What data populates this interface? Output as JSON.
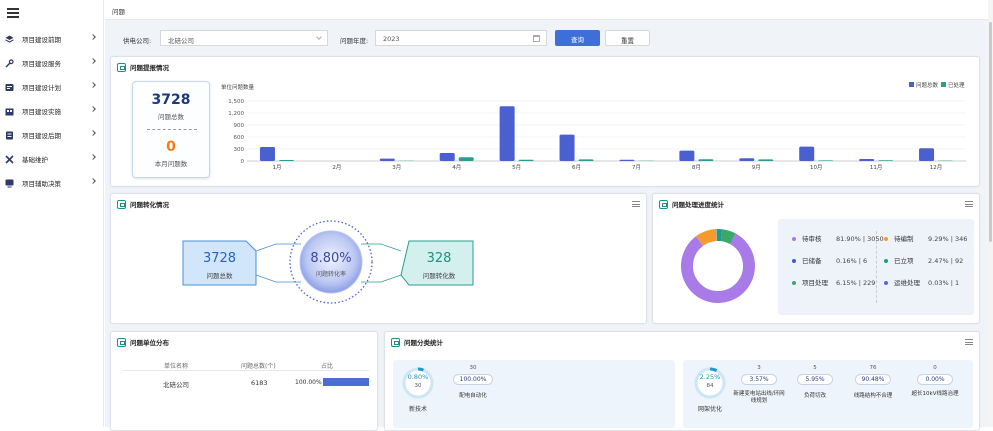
{
  "sidebar": {
    "items": [
      {
        "label": "项目建设前期",
        "icon": "layers-icon"
      },
      {
        "label": "项目建设服务",
        "icon": "tools-icon"
      },
      {
        "label": "项目建设计划",
        "icon": "plan-icon"
      },
      {
        "label": "项目建设实施",
        "icon": "build-icon"
      },
      {
        "label": "项目建设后期",
        "icon": "archive-icon"
      },
      {
        "label": "基础维护",
        "icon": "wrench-icon"
      },
      {
        "label": "项目辅助决策",
        "icon": "monitor-icon"
      }
    ]
  },
  "breadcrumb": "问题",
  "filter": {
    "company_label": "供电公司:",
    "company_value": "北碚公司",
    "year_label": "问题年度:",
    "year_value": "2023",
    "query_label": "查询",
    "reset_label": "重置"
  },
  "raise": {
    "title": "问题提报情况",
    "total_value": "3728",
    "total_label": "问题总数",
    "month_value": "0",
    "month_label": "本月问题数"
  },
  "chart_data": {
    "type": "bar",
    "title": "",
    "ylabel": "单位问题数量",
    "ylim": [
      0,
      1500
    ],
    "yticks": [
      "1,500",
      "1,200",
      "900",
      "600",
      "300",
      "0"
    ],
    "categories": [
      "1月",
      "2月",
      "3月",
      "4月",
      "5月",
      "6月",
      "7月",
      "8月",
      "9月",
      "10月",
      "11月",
      "12月"
    ],
    "series": [
      {
        "name": "问题总数",
        "color": "#4a5fd0",
        "values": [
          350,
          0,
          60,
          200,
          1370,
          660,
          30,
          260,
          70,
          360,
          50,
          320
        ]
      },
      {
        "name": "已处理",
        "color": "#2a9d8f",
        "values": [
          25,
          0,
          5,
          95,
          30,
          40,
          5,
          45,
          40,
          15,
          20,
          10
        ]
      }
    ],
    "legend": "top-right",
    "grid": true
  },
  "conversion": {
    "title": "问题转化情况",
    "left_value": "3728",
    "left_label": "问题总数",
    "center_value": "8.80%",
    "center_label": "问题转化率",
    "right_value": "328",
    "right_label": "问题转化数"
  },
  "progress": {
    "title": "问题处理进度统计",
    "items": [
      {
        "label": "待审核",
        "value": "81.90% | 3050",
        "color": "#a97be8",
        "pct": 81.9
      },
      {
        "label": "待编制",
        "value": "9.29% | 346",
        "color": "#f79a2e",
        "pct": 9.29
      },
      {
        "label": "已储备",
        "value": "0.16% | 6",
        "color": "#3b5bd6",
        "pct": 0.16
      },
      {
        "label": "已立项",
        "value": "2.47% | 92",
        "color": "#1f9a8e",
        "pct": 2.47
      },
      {
        "label": "项目处理",
        "value": "6.15% | 229",
        "color": "#3aa86b",
        "pct": 6.15
      },
      {
        "label": "运维处理",
        "value": "0.03% | 1",
        "color": "#5a6ad8",
        "pct": 0.03
      }
    ]
  },
  "unit": {
    "title": "问题单位分布",
    "headers": [
      "单位名称",
      "问题总数(个)",
      "占比"
    ],
    "rows": [
      {
        "name": "北碚公司",
        "count": "6183",
        "pct": "100.00%",
        "ratio": 1.0
      }
    ]
  },
  "category": {
    "title": "问题分类统计",
    "group1": {
      "ring_value": "0.80%",
      "ring_count": "30",
      "ring_pct": 0.8,
      "name": "新技术",
      "subs": [
        {
          "count": "30",
          "pct": "100.00%",
          "label": "配电自动化"
        }
      ]
    },
    "group2": {
      "ring_value": "2.25%",
      "ring_count": "84",
      "ring_pct": 2.25,
      "name": "网架优化",
      "subs": [
        {
          "count": "3",
          "pct": "3.57%",
          "label": "新建变电站出线/环网线规划"
        },
        {
          "count": "5",
          "pct": "5.95%",
          "label": "负荷切改"
        },
        {
          "count": "76",
          "pct": "90.48%",
          "label": "线路结构不合理"
        },
        {
          "count": "0",
          "pct": "0.00%",
          "label": "超长10kV线路治理"
        }
      ]
    }
  }
}
